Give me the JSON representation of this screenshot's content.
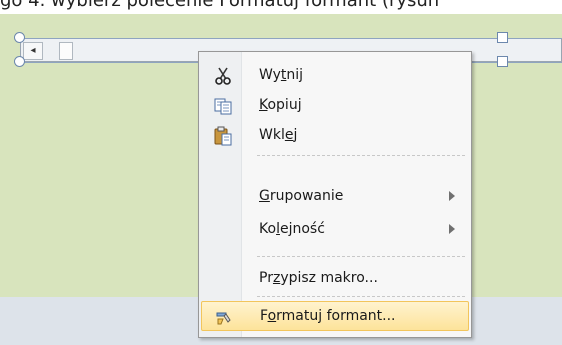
{
  "caption": "go 4. wybierz polecenie Formatuj formant (rysun",
  "context_menu": {
    "items": [
      {
        "pre": "Wy",
        "accel": "t",
        "post": "nij",
        "icon": "scissors-icon",
        "submenu": false
      },
      {
        "pre": "",
        "accel": "K",
        "post": "opiuj",
        "icon": "copy-icon",
        "submenu": false
      },
      {
        "pre": "Wkl",
        "accel": "e",
        "post": "j",
        "icon": "paste-icon",
        "submenu": false
      },
      {
        "pre": "",
        "accel": "G",
        "post": "rupowanie",
        "icon": "",
        "submenu": true
      },
      {
        "pre": "Ko",
        "accel": "l",
        "post": "ejność",
        "icon": "",
        "submenu": true
      },
      {
        "pre": "Pr",
        "accel": "z",
        "post": "ypisz makro...",
        "icon": "",
        "submenu": false
      },
      {
        "pre": "F",
        "accel": "o",
        "post": "rmatuj formant...",
        "icon": "format-control-icon",
        "submenu": false
      }
    ]
  },
  "colors": {
    "sheet_background": "#d8e4bd",
    "menu_highlight": "#fde39a",
    "handle_border": "#6c88ad"
  }
}
